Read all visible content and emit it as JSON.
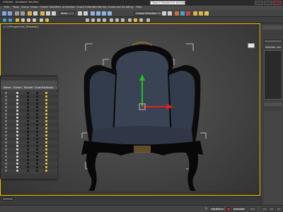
{
  "titlebar": {
    "title": "Untitled - Autodesk 3ds Max",
    "search_placeholder": "Type a keyword or phrase"
  },
  "menubar": [
    "Edit",
    "Tools",
    "Group",
    "Views",
    "Create",
    "Modifiers",
    "Animation",
    "Graph Editors",
    "Rendering",
    "Customize",
    "Scripting",
    "Help"
  ],
  "toolbar": {
    "refcoord_value": "View",
    "selset_value": "Create Selection Se"
  },
  "viewport": {
    "label": "[+] [Perspective] [Realistic]"
  },
  "command_panel": {
    "modifier_label": "Modifier List"
  },
  "scene_explorer": {
    "columns": [
      "Name",
      "Frozen",
      "Render",
      "Color",
      "Radiosity"
    ],
    "row_count": 23
  },
  "timeslider": {
    "value": "0 / 100"
  },
  "statusbar": {
    "x_label": "X:",
    "x_value": "-58,861cm",
    "y_label": "Y:",
    "y_value": "",
    "z_label": "Z:",
    "z_value": "",
    "grid_value": "Grid = 10,0cm",
    "autokey_label": "Auto Key",
    "selected_label": "Selected"
  },
  "colors": {
    "gizmo_y": "#22c022",
    "gizmo_x": "#e02020",
    "active_border": "#f0c000",
    "upholstery": "#3a4354",
    "wood": "#0c0c0c"
  }
}
